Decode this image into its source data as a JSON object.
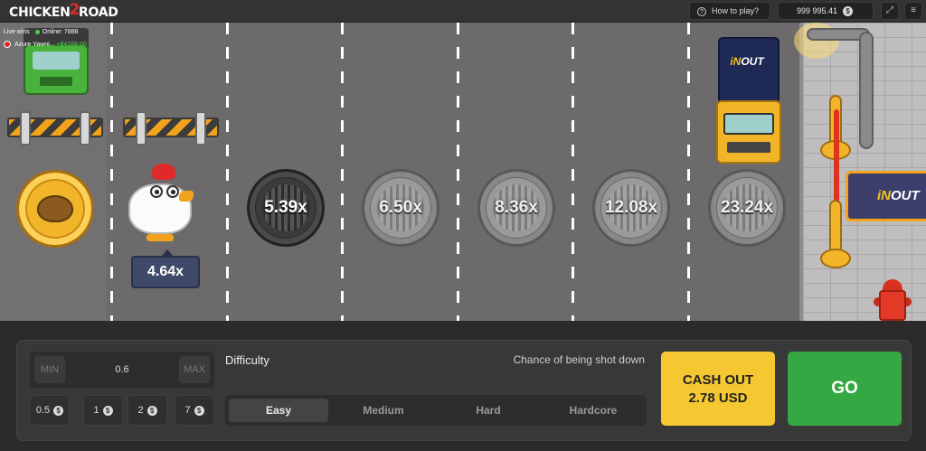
{
  "header": {
    "logo_left": "CHICKEN",
    "logo_mid": "2",
    "logo_right": "ROAD",
    "how_to_play": "How to play?",
    "balance": "999 995.41",
    "currency_icon": "$",
    "fullscreen_icon": "⤢",
    "menu_icon": "≡"
  },
  "live_wins": {
    "label": "Live wins",
    "online": "Online: 7888",
    "player": "Azure Yawni...",
    "amount": "+$4168.00"
  },
  "road": {
    "current_multiplier": "4.64x",
    "multipliers": [
      "5.39x",
      "6.50x",
      "8.36x",
      "12.08x",
      "23.24x"
    ],
    "truck_logo_left": "iN",
    "truck_logo_right": "OUT",
    "sign_left": "iN",
    "sign_right": "OUT"
  },
  "controls": {
    "min_label": "MIN",
    "bet_value": "0.6",
    "max_label": "MAX",
    "chips": [
      "0.5",
      "1",
      "2",
      "7"
    ],
    "chip_icon": "$",
    "difficulty_label": "Difficulty",
    "chance_label": "Chance of being shot down",
    "difficulties": [
      "Easy",
      "Medium",
      "Hard",
      "Hardcore"
    ],
    "selected_difficulty": "Easy",
    "cashout_line1": "CASH OUT",
    "cashout_line2": "2.78 USD",
    "go_label": "GO"
  },
  "colors": {
    "road": "#6c6a6a",
    "cashout": "#f5c832",
    "go": "#36a843",
    "tag": "#3f4a6a"
  }
}
